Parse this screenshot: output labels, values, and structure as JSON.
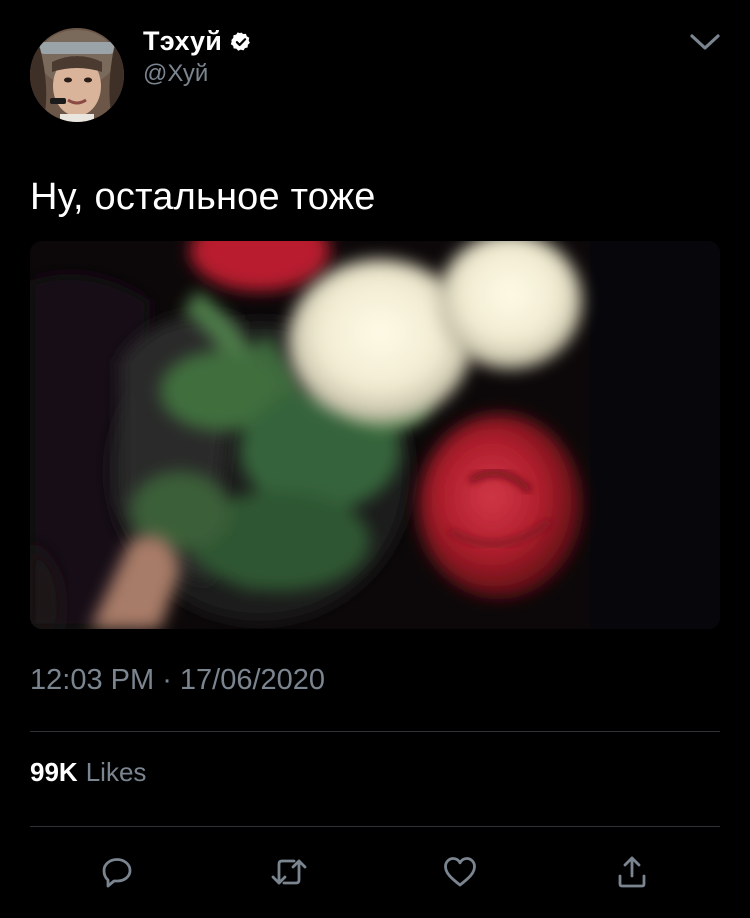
{
  "author": {
    "display_name": "Тэхуй",
    "handle": "@Хуй",
    "verified_icon": "verified-badge-icon"
  },
  "tweet": {
    "text": "Ну, остальное тоже",
    "time": "12:03 PM",
    "separator": " · ",
    "date": "17/06/2020"
  },
  "stats": {
    "likes_count": "99K",
    "likes_label": "Likes"
  },
  "actions": {
    "reply_icon": "reply-icon",
    "retweet_icon": "retweet-icon",
    "like_icon": "heart-icon",
    "share_icon": "share-icon"
  },
  "menu_icon": "chevron-down-icon",
  "colors": {
    "background": "#000000",
    "text_primary": "#ffffff",
    "text_secondary": "#7b8590",
    "divider": "#2f3336",
    "icon": "#7b8590"
  }
}
